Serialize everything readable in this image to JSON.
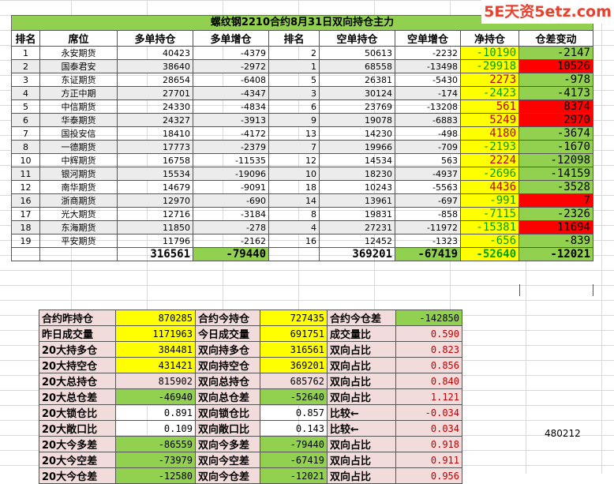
{
  "title": "螺纹钢2210合约8月31日双向持仓主力",
  "watermark": "5E天资5etz.com",
  "headers": [
    "排名",
    "席位",
    "多单持仓",
    "多单增仓",
    "排名",
    "空单持仓",
    "空单增仓",
    "净持仓",
    "仓差变动"
  ],
  "rows": [
    {
      "rank": "1",
      "broker": "永安期货",
      "long": "40423",
      "long_chg": "-4379",
      "srank": "2",
      "short": "50613",
      "short_chg": "-2232",
      "net": "-10190",
      "net_style": "yellow-green",
      "diff": "-2147",
      "diff_style": "green"
    },
    {
      "rank": "2",
      "broker": "国泰君安",
      "long": "38640",
      "long_chg": "-2972",
      "srank": "1",
      "short": "68558",
      "short_chg": "-13498",
      "net": "-29918",
      "net_style": "yellow-green",
      "diff": "10526",
      "diff_style": "red"
    },
    {
      "rank": "3",
      "broker": "东证期货",
      "long": "28654",
      "long_chg": "-6408",
      "srank": "5",
      "short": "26381",
      "short_chg": "-5430",
      "net": "2273",
      "net_style": "yellow-red",
      "diff": "-978",
      "diff_style": "green"
    },
    {
      "rank": "4",
      "broker": "方正中期",
      "long": "27701",
      "long_chg": "-4347",
      "srank": "3",
      "short": "30124",
      "short_chg": "-174",
      "net": "-2423",
      "net_style": "yellow-green",
      "diff": "-4173",
      "diff_style": "green"
    },
    {
      "rank": "5",
      "broker": "中信期货",
      "long": "24330",
      "long_chg": "-4834",
      "srank": "6",
      "short": "23769",
      "short_chg": "-13208",
      "net": "561",
      "net_style": "yellow-red",
      "diff": "8374",
      "diff_style": "red"
    },
    {
      "rank": "6",
      "broker": "华泰期货",
      "long": "24327",
      "long_chg": "-3913",
      "srank": "9",
      "short": "19078",
      "short_chg": "-6883",
      "net": "5249",
      "net_style": "yellow-red",
      "diff": "2970",
      "diff_style": "red"
    },
    {
      "rank": "7",
      "broker": "国投安信",
      "long": "18410",
      "long_chg": "-4172",
      "srank": "13",
      "short": "14230",
      "short_chg": "-498",
      "net": "4180",
      "net_style": "yellow-red",
      "diff": "-3674",
      "diff_style": "green"
    },
    {
      "rank": "8",
      "broker": "一德期货",
      "long": "17773",
      "long_chg": "-2379",
      "srank": "7",
      "short": "19966",
      "short_chg": "-709",
      "net": "-2193",
      "net_style": "yellow-green",
      "diff": "-1670",
      "diff_style": "green"
    },
    {
      "rank": "10",
      "broker": "中辉期货",
      "long": "16758",
      "long_chg": "-11535",
      "srank": "12",
      "short": "14534",
      "short_chg": "563",
      "net": "2224",
      "net_style": "yellow-red",
      "diff": "-12098",
      "diff_style": "green"
    },
    {
      "rank": "11",
      "broker": "银河期货",
      "long": "15534",
      "long_chg": "-19096",
      "srank": "10",
      "short": "18230",
      "short_chg": "-4937",
      "net": "-2696",
      "net_style": "yellow-green",
      "diff": "-14159",
      "diff_style": "green"
    },
    {
      "rank": "12",
      "broker": "南华期货",
      "long": "14679",
      "long_chg": "-9091",
      "srank": "18",
      "short": "10243",
      "short_chg": "-5563",
      "net": "4436",
      "net_style": "yellow-red",
      "diff": "-3528",
      "diff_style": "green"
    },
    {
      "rank": "16",
      "broker": "浙商期货",
      "long": "12970",
      "long_chg": "-690",
      "srank": "14",
      "short": "13961",
      "short_chg": "-697",
      "net": "-991",
      "net_style": "yellow-green",
      "diff": "7",
      "diff_style": "red"
    },
    {
      "rank": "17",
      "broker": "光大期货",
      "long": "12716",
      "long_chg": "-3184",
      "srank": "8",
      "short": "19831",
      "short_chg": "-858",
      "net": "-7115",
      "net_style": "yellow-green",
      "diff": "-2326",
      "diff_style": "green"
    },
    {
      "rank": "18",
      "broker": "东海期货",
      "long": "11850",
      "long_chg": "-278",
      "srank": "4",
      "short": "27231",
      "short_chg": "-11972",
      "net": "-15381",
      "net_style": "yellow-green",
      "diff": "11694",
      "diff_style": "red"
    },
    {
      "rank": "19",
      "broker": "平安期货",
      "long": "11796",
      "long_chg": "-2162",
      "srank": "16",
      "short": "12452",
      "short_chg": "-1323",
      "net": "-656",
      "net_style": "yellow-green",
      "diff": "-839",
      "diff_style": "green"
    }
  ],
  "totals": {
    "long": "316561",
    "long_chg": "-79440",
    "short": "369201",
    "short_chg": "-67419",
    "net": "-52640",
    "diff": "-12021"
  },
  "summary": [
    {
      "l1": "合约昨持仓",
      "v1": "870285",
      "v1_style": "yellow",
      "l2": "合约今持仓",
      "v2": "727435",
      "v2_style": "yellow",
      "l3": "合约今仓差",
      "v3": "-142850",
      "v3_style": "green"
    },
    {
      "l1": "昨日成交量",
      "v1": "1171963",
      "v1_style": "yellow",
      "l2": "今日成交量",
      "v2": "691751",
      "v2_style": "yellow",
      "l3": "成交量比",
      "v3": "0.590",
      "v3_style": "ratio"
    },
    {
      "l1": "20大持多仓",
      "v1": "384481",
      "v1_style": "yellow",
      "l2": "双向持多仓",
      "v2": "316561",
      "v2_style": "yellow",
      "l3": "双向占比",
      "v3": "0.823",
      "v3_style": "ratio"
    },
    {
      "l1": "20大持空仓",
      "v1": "431421",
      "v1_style": "yellow",
      "l2": "双向持空仓",
      "v2": "369201",
      "v2_style": "yellow",
      "l3": "双向占比",
      "v3": "0.856",
      "v3_style": "ratio"
    },
    {
      "l1": "20大总持仓",
      "v1": "815902",
      "v1_style": "pink",
      "l2": "双向总持仓",
      "v2": "685762",
      "v2_style": "pink",
      "l3": "双向占比",
      "v3": "0.840",
      "v3_style": "ratio"
    },
    {
      "l1": "20大总仓差",
      "v1": "-46940",
      "v1_style": "green",
      "l2": "双向总仓差",
      "v2": "-52640",
      "v2_style": "green",
      "l3": "双向占比",
      "v3": "1.121",
      "v3_style": "ratio"
    },
    {
      "l1": "20大锁仓比",
      "v1": "0.891",
      "v1_style": "plain",
      "l2": "双向锁仓比",
      "v2": "0.857",
      "v2_style": "plain",
      "l3": "比较←",
      "v3": "-0.034",
      "v3_style": "ratio"
    },
    {
      "l1": "20大敞口比",
      "v1": "0.109",
      "v1_style": "plain",
      "l2": "双向敞口比",
      "v2": "0.143",
      "v2_style": "plain",
      "l3": "比较←",
      "v3": "0.034",
      "v3_style": "ratio"
    },
    {
      "l1": "20大今多差",
      "v1": "-86559",
      "v1_style": "green",
      "l2": "双向今多差",
      "v2": "-79440",
      "v2_style": "green",
      "l3": "双向占比",
      "v3": "0.918",
      "v3_style": "ratio"
    },
    {
      "l1": "20大今空差",
      "v1": "-73979",
      "v1_style": "green",
      "l2": "双向今空差",
      "v2": "-67419",
      "v2_style": "green",
      "l3": "双向占比",
      "v3": "0.911",
      "v3_style": "ratio"
    },
    {
      "l1": "20大今仓差",
      "v1": "-12580",
      "v1_style": "green",
      "l2": "双向今仓差",
      "v2": "-12021",
      "v2_style": "green",
      "l3": "双向占比",
      "v3": "0.956",
      "v3_style": "ratio"
    }
  ],
  "loose_value": "480212",
  "colors": {
    "green": "#92d050",
    "yellow": "#ffff00",
    "red": "#ff0000",
    "pink": "#f2dcdb"
  }
}
